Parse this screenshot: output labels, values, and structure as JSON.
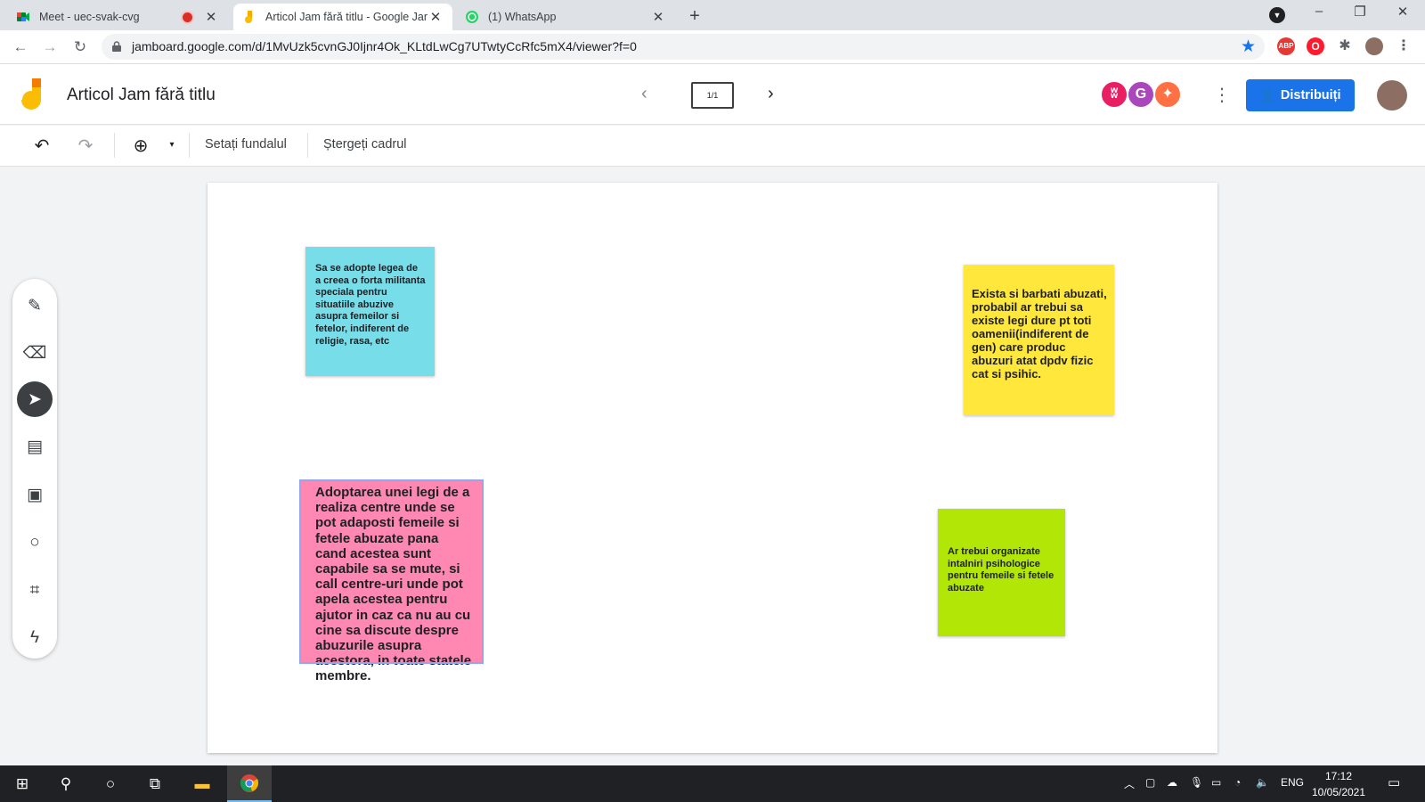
{
  "browser": {
    "tabs": [
      {
        "title": "Meet - uec-svak-cvg",
        "recording": true
      },
      {
        "title": "Articol Jam fără titlu - Google Jam",
        "active": true
      },
      {
        "title": "(1) WhatsApp"
      }
    ],
    "new_tab": "+",
    "url": "jamboard.google.com/d/1MvUzk5cvnGJ0Ijnr4Ok_KLtdLwCg7UTwtyCcRfc5mX4/viewer?f=0",
    "extensions": [
      "ABP"
    ],
    "window_controls": {
      "minimize": "–",
      "restore": "❐",
      "close": "✕"
    }
  },
  "app": {
    "doc_title": "Articol Jam fără titlu",
    "frame_indicator": "1/1",
    "share_label": "Distribuiți",
    "brand_color": "#1a73e8"
  },
  "edit_toolbar": {
    "set_background": "Setați fundalul",
    "delete_frame": "Ștergeți cadrul"
  },
  "tools": [
    {
      "name": "pen",
      "icon": "pen-icon"
    },
    {
      "name": "eraser",
      "icon": "eraser-icon"
    },
    {
      "name": "select",
      "icon": "select-arrow-icon",
      "active": true
    },
    {
      "name": "sticky-note",
      "icon": "sticky-note-icon"
    },
    {
      "name": "image",
      "icon": "image-icon"
    },
    {
      "name": "circle",
      "icon": "circle-icon"
    },
    {
      "name": "text-box",
      "icon": "text-box-icon"
    },
    {
      "name": "laser",
      "icon": "laser-icon"
    }
  ],
  "notes": [
    {
      "color": "#77dde9",
      "text": "Sa se adopte legea de a creea o forta militanta speciala pentru situatiile abuzive asupra femeilor si fetelor, indiferent de religie, rasa, etc"
    },
    {
      "color": "#ffe83b",
      "text": "Exista si barbati abuzati, probabil ar trebui sa existe legi dure pt toti oamenii(indiferent de gen) care produc abuzuri atat dpdv fizic cat si psihic."
    },
    {
      "color": "#fe88b1",
      "text": "Adoptarea unei legi de a realiza centre unde se pot adaposti femeile si fetele abuzate pana cand acestea sunt capabile sa se mute, si call centre-uri unde pot apela acestea pentru ajutor in caz ca nu au cu cine sa discute despre abuzurile asupra acestora, in toate statele membre."
    },
    {
      "color": "#b2e607",
      "text": "Ar trebui organizate intalniri psihologice pentru femeile si fetele abuzate"
    }
  ],
  "taskbar": {
    "language": "ENG",
    "time": "17:12",
    "date": "10/05/2021"
  }
}
